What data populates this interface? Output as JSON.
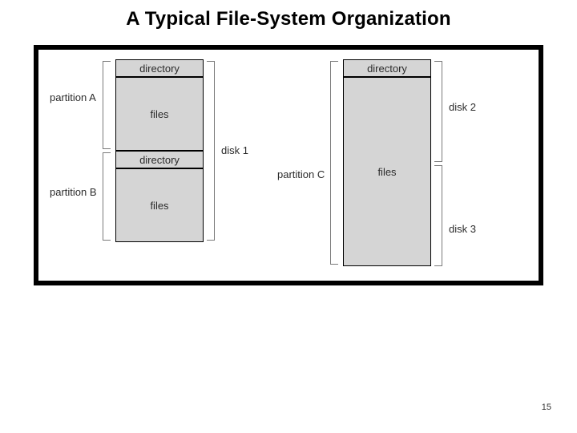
{
  "title": "A Typical File-System Organization",
  "page_number": "15",
  "left_stack": {
    "partition_a": {
      "label": "partition A",
      "dir": "directory",
      "files": "files"
    },
    "partition_b": {
      "label": "partition B",
      "dir": "directory",
      "files": "files"
    },
    "disk_label": "disk 1"
  },
  "right_stack": {
    "partition_c": {
      "label": "partition C",
      "dir": "directory",
      "files": "files"
    },
    "disk2_label": "disk 2",
    "disk3_label": "disk 3"
  }
}
